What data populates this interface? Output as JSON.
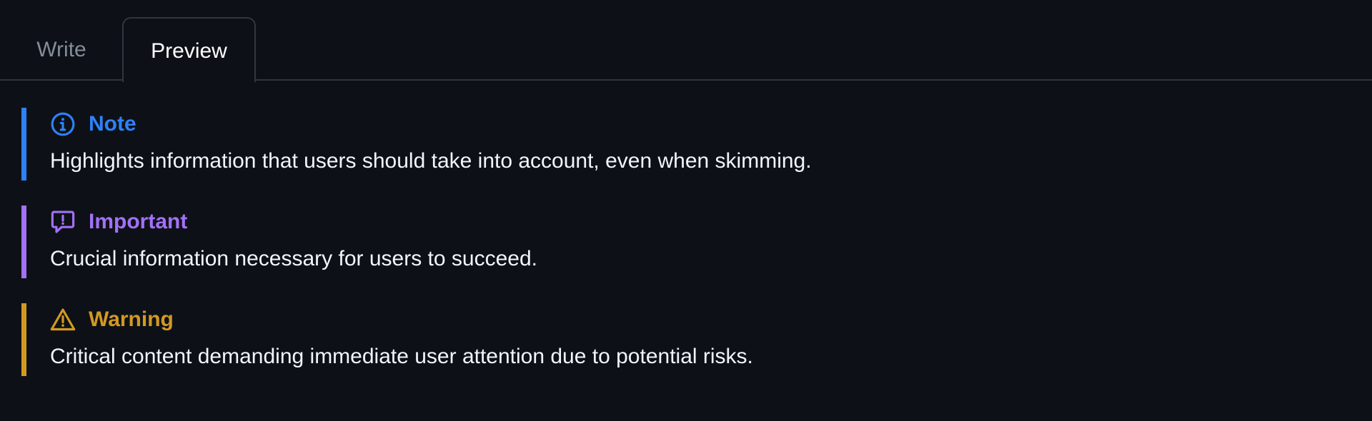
{
  "tabs": {
    "write_label": "Write",
    "preview_label": "Preview",
    "active": "Preview"
  },
  "alerts": [
    {
      "title": "Note",
      "text": "Highlights information that users should take into account, even when skimming.",
      "icon": "info-icon",
      "color": "#2f81f7"
    },
    {
      "title": "Important",
      "text": "Crucial information necessary for users to succeed.",
      "icon": "report-icon",
      "color": "#a371f7"
    },
    {
      "title": "Warning",
      "text": "Critical content demanding immediate user attention due to potential risks.",
      "icon": "alert-triangle-icon",
      "color": "#d29922"
    }
  ]
}
